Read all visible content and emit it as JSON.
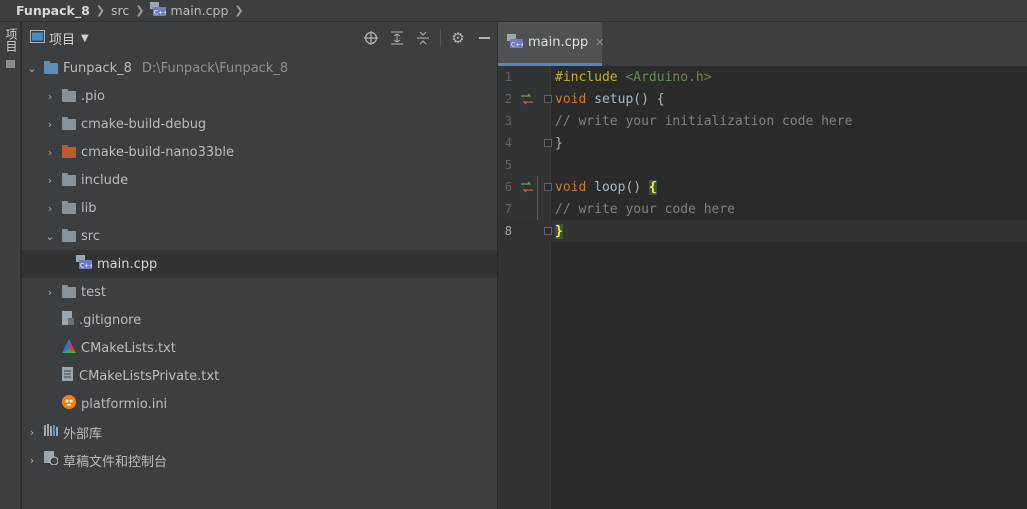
{
  "breadcrumb": {
    "project": "Funpack_8",
    "folder": "src",
    "file": "main.cpp"
  },
  "toolstrip": {
    "project_tab_label": "项目"
  },
  "project_panel": {
    "title": "项目",
    "tree": {
      "root": {
        "name": "Funpack_8",
        "path": "D:\\Funpack\\Funpack_8"
      },
      "children": [
        {
          "name": ".pio"
        },
        {
          "name": "cmake-build-debug"
        },
        {
          "name": "cmake-build-nano33ble"
        },
        {
          "name": "include"
        },
        {
          "name": "lib"
        },
        {
          "name": "src"
        },
        {
          "name": "main.cpp"
        },
        {
          "name": "test"
        },
        {
          "name": ".gitignore"
        },
        {
          "name": "CMakeLists.txt"
        },
        {
          "name": "CMakeListsPrivate.txt"
        },
        {
          "name": "platformio.ini"
        }
      ],
      "external_libraries": "外部库",
      "scratches": "草稿文件和控制台"
    }
  },
  "editor": {
    "tab_label": "main.cpp",
    "line_numbers": [
      "1",
      "2",
      "3",
      "4",
      "5",
      "6",
      "7",
      "8"
    ],
    "code": {
      "l1_directive": "#include",
      "l1_header": "<Arduino.h>",
      "l2_keyword": "void",
      "l2_rest": " setup() {",
      "l3_comment": "// write your initialization code here",
      "l4_brace": "}",
      "l6_keyword": "void",
      "l6_rest": " loop() ",
      "l6_brace": "{",
      "l7_comment": "// write your code here",
      "l8_brace": "}"
    }
  },
  "colors": {
    "accent": "#4a88c7",
    "keyword": "#cc7832",
    "comment": "#808080",
    "string": "#6a8759",
    "preprocessor": "#bbb529"
  }
}
